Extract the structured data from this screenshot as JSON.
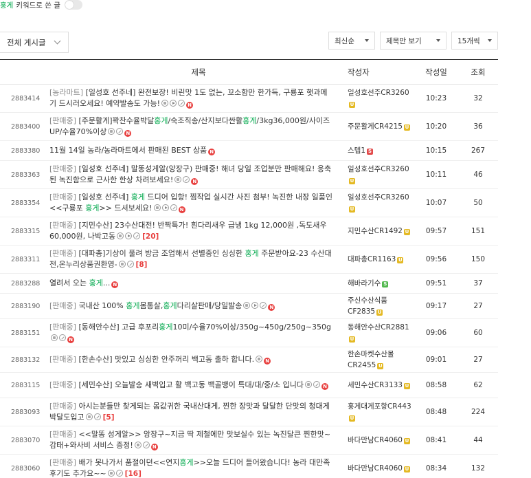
{
  "keyword_filter": {
    "keyword": "홍게",
    "label": " 키워드로 쓴 글"
  },
  "board_select": {
    "label": "전체 게시글"
  },
  "sort": {
    "label": "최신순"
  },
  "view": {
    "label": "제목만 보기"
  },
  "per_page": {
    "label": "15개씩"
  },
  "columns": {
    "title": "제목",
    "author": "작성자",
    "date": "작성일",
    "views": "조회"
  },
  "posts": [
    {
      "no": "2883414",
      "parts": [
        {
          "t": "[농라마트] ",
          "s": "cat"
        },
        {
          "t": "[일성호 선주네] 완전보장! 비린맛 1도 없는, 꼬소함만 한가득, 구룡포 햇과메기 드시러오세요! 예약발송도 가능!",
          "s": ""
        }
      ],
      "icons": [
        "img",
        "vid",
        "file",
        "new"
      ],
      "comments": "",
      "author": "일성호선주CR3260",
      "badge": "gold",
      "date": "10:23",
      "views": "32"
    },
    {
      "no": "2883400",
      "parts": [
        {
          "t": "[판매중] ",
          "s": "cat"
        },
        {
          "t": "[주문활게]꽉찬수율박달",
          "s": ""
        },
        {
          "t": "홍게",
          "s": "hl"
        },
        {
          "t": "/숙조직송/산지보다싼활",
          "s": ""
        },
        {
          "t": "홍게",
          "s": "hl"
        },
        {
          "t": "/3kg36,000원/사이즈UP/수율70%이상",
          "s": ""
        }
      ],
      "icons": [
        "img",
        "file",
        "new"
      ],
      "comments": "",
      "author": "주문활게CR4215",
      "badge": "gold",
      "date": "10:20",
      "views": "36"
    },
    {
      "no": "2883380",
      "parts": [
        {
          "t": "11월 14일 농라/농라마트에서 판매된 BEST 상품",
          "s": ""
        }
      ],
      "icons": [
        "new"
      ],
      "comments": "",
      "author": "스텝1",
      "badge": "red",
      "date": "10:15",
      "views": "267"
    },
    {
      "no": "2883363",
      "parts": [
        {
          "t": "[판매중] ",
          "s": "cat"
        },
        {
          "t": "[일성호 선주네] 말똥성게알(앙장구) 판매중! 해녀 당일 조업분만 판매해요! 응축된 녹진함으로 근사한 한상 차려보세요!",
          "s": ""
        }
      ],
      "icons": [
        "img",
        "file",
        "new"
      ],
      "comments": "",
      "author": "일성호선주CR3260",
      "badge": "gold",
      "date": "10:11",
      "views": "46"
    },
    {
      "no": "2883354",
      "parts": [
        {
          "t": "[판매중] ",
          "s": "cat"
        },
        {
          "t": "[일성호 선주네] ",
          "s": ""
        },
        {
          "t": "홍게",
          "s": "hl"
        },
        {
          "t": " 드디어 입항! 찜작업 실시간 사진 첨부! 녹진한 내장 일품인 <<구룡포 ",
          "s": ""
        },
        {
          "t": "홍게",
          "s": "hl"
        },
        {
          "t": ">> 드셔보세요!",
          "s": ""
        }
      ],
      "icons": [
        "img",
        "vid",
        "file",
        "new"
      ],
      "comments": "",
      "author": "일성호선주CR3260",
      "badge": "gold",
      "date": "10:07",
      "views": "50"
    },
    {
      "no": "2883315",
      "parts": [
        {
          "t": "[판매중] ",
          "s": "cat"
        },
        {
          "t": "[지민수산] 23수산대전! 반짝특가! 흰다리새우 급냉 1kg 12,000원 ,독도새우 60,000원, 나박고동",
          "s": ""
        }
      ],
      "icons": [
        "img",
        "vid",
        "file"
      ],
      "comments": "[20]",
      "author": "지민수산CR1492",
      "badge": "gold",
      "date": "09:57",
      "views": "151"
    },
    {
      "no": "2883311",
      "parts": [
        {
          "t": "[판매중] ",
          "s": "cat"
        },
        {
          "t": "[대파총]기상이 풀려 방금 조업해서 선별중인 싱싱한 ",
          "s": ""
        },
        {
          "t": "홍게",
          "s": "hl"
        },
        {
          "t": " 주문받아요-23 수산대전,온누리상품권환영-",
          "s": ""
        }
      ],
      "icons": [
        "img",
        "file"
      ],
      "comments": "[8]",
      "author": "대파총CR1163",
      "badge": "gold",
      "date": "09:56",
      "views": "150"
    },
    {
      "no": "2883288",
      "parts": [
        {
          "t": "열려서 오는 ",
          "s": ""
        },
        {
          "t": "홍게",
          "s": "hl"
        },
        {
          "t": "...",
          "s": ""
        }
      ],
      "icons": [
        "new"
      ],
      "comments": "",
      "author": "해바라기수",
      "badge": "green",
      "date": "09:51",
      "views": "37"
    },
    {
      "no": "2883190",
      "parts": [
        {
          "t": "[판매중] ",
          "s": "cat"
        },
        {
          "t": "국내산 100% ",
          "s": ""
        },
        {
          "t": "홍게",
          "s": "hl"
        },
        {
          "t": "몸통살,",
          "s": ""
        },
        {
          "t": "홍게",
          "s": "hl"
        },
        {
          "t": "다리살판매/당일발송",
          "s": ""
        }
      ],
      "icons": [
        "img",
        "vid",
        "file",
        "new"
      ],
      "comments": "",
      "author": "주신수산식품CF2835",
      "badge": "gold",
      "date": "09:17",
      "views": "27"
    },
    {
      "no": "2883151",
      "parts": [
        {
          "t": "[판매중] ",
          "s": "cat"
        },
        {
          "t": "[동해안수산] 고급 후포리",
          "s": ""
        },
        {
          "t": "홍게",
          "s": "hl"
        },
        {
          "t": "10미/수율70%이상/350g~450g/250g~350g",
          "s": ""
        }
      ],
      "icons": [
        "img",
        "file",
        "new"
      ],
      "comments": "",
      "author": "동해안수산CR2881",
      "badge": "gold",
      "date": "09:06",
      "views": "60"
    },
    {
      "no": "2883132",
      "parts": [
        {
          "t": "[판매중] ",
          "s": "cat"
        },
        {
          "t": "[한손수산] 맛있고 싱싱한 안주꺼리 백고동 출하 합니다.",
          "s": ""
        }
      ],
      "icons": [
        "img",
        "new"
      ],
      "comments": "",
      "author": "한손마켓수산몰CR2455",
      "badge": "gold",
      "date": "09:01",
      "views": "27"
    },
    {
      "no": "2883115",
      "parts": [
        {
          "t": "[판매중] ",
          "s": "cat"
        },
        {
          "t": "[세민수산] 오늘발송 새벽입고 활 백고동 백골뱅이 특대/대/중/소 입니다",
          "s": ""
        }
      ],
      "icons": [
        "img",
        "file",
        "new"
      ],
      "comments": "",
      "author": "세민수산CR3133",
      "badge": "gold",
      "date": "08:58",
      "views": "62"
    },
    {
      "no": "2883093",
      "parts": [
        {
          "t": "[판매중] ",
          "s": "cat"
        },
        {
          "t": "아시는분들만 찾게되는 몸값귀한 국내산대게, 찐한 장맛과 달달한 단맛의 청대게 박달도입고",
          "s": ""
        }
      ],
      "icons": [
        "img",
        "file"
      ],
      "comments": "[5]",
      "author": "홍게대게포항CR443",
      "badge": "gold",
      "date": "08:48",
      "views": "224"
    },
    {
      "no": "2883070",
      "parts": [
        {
          "t": "[판매중] ",
          "s": "cat"
        },
        {
          "t": "<<말똥 성게알>> 앙장구~지금 딱 제철에만 맛보실수 있는 녹진달큰 찐한맛~ 감태+와사비 서비스 증정!",
          "s": ""
        }
      ],
      "icons": [
        "img",
        "file",
        "new"
      ],
      "comments": "",
      "author": "바다만남CR4060",
      "badge": "gold",
      "date": "08:41",
      "views": "44"
    },
    {
      "no": "2883060",
      "parts": [
        {
          "t": "[판매중] ",
          "s": "cat"
        },
        {
          "t": "배가 못나가서 품절이던<<연지",
          "s": ""
        },
        {
          "t": "홍게",
          "s": "hl"
        },
        {
          "t": ">>오늘 드디어 들어왔습니다! 농라 대만족 후기도 추가요~~",
          "s": ""
        }
      ],
      "icons": [
        "img",
        "file"
      ],
      "comments": "[16]",
      "author": "바다만남CR4060",
      "badge": "gold",
      "date": "08:34",
      "views": "132"
    }
  ],
  "icon_names": {
    "img": "image-icon",
    "vid": "video-icon",
    "file": "attachment-icon",
    "new": "new-icon"
  },
  "badge_text": {
    "gold": "U",
    "green": "S",
    "red": "S"
  },
  "colors": {
    "keyword_highlight": "#03a94d",
    "comment_count": "#e8403f",
    "new_badge": "#e8403f",
    "rank_badge": "#e4b923"
  }
}
